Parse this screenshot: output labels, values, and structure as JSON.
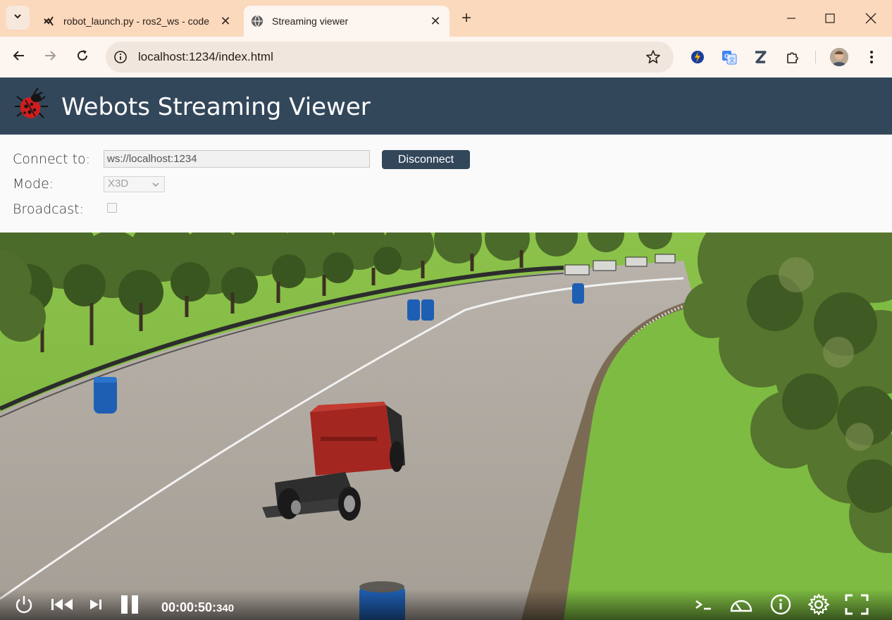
{
  "tabs": [
    {
      "title": "robot_launch.py - ros2_ws - code",
      "favicon": "vscode-icon",
      "active": false
    },
    {
      "title": "Streaming viewer",
      "favicon": "globe-icon",
      "active": true
    }
  ],
  "address_bar": {
    "url": "localhost:1234/index.html"
  },
  "page": {
    "header_title": "Webots Streaming Viewer",
    "connect_label": "Connect to:",
    "connect_value": "ws://localhost:1234",
    "disconnect_label": "Disconnect",
    "mode_label": "Mode:",
    "mode_value": "X3D",
    "broadcast_label": "Broadcast:",
    "broadcast_checked": false
  },
  "player": {
    "time_main": "00:00:50:",
    "time_ms": "340",
    "state": "playing"
  },
  "colors": {
    "tabstrip": "#fbd9bd",
    "header": "#33475b",
    "accent_button": "#33475b"
  }
}
